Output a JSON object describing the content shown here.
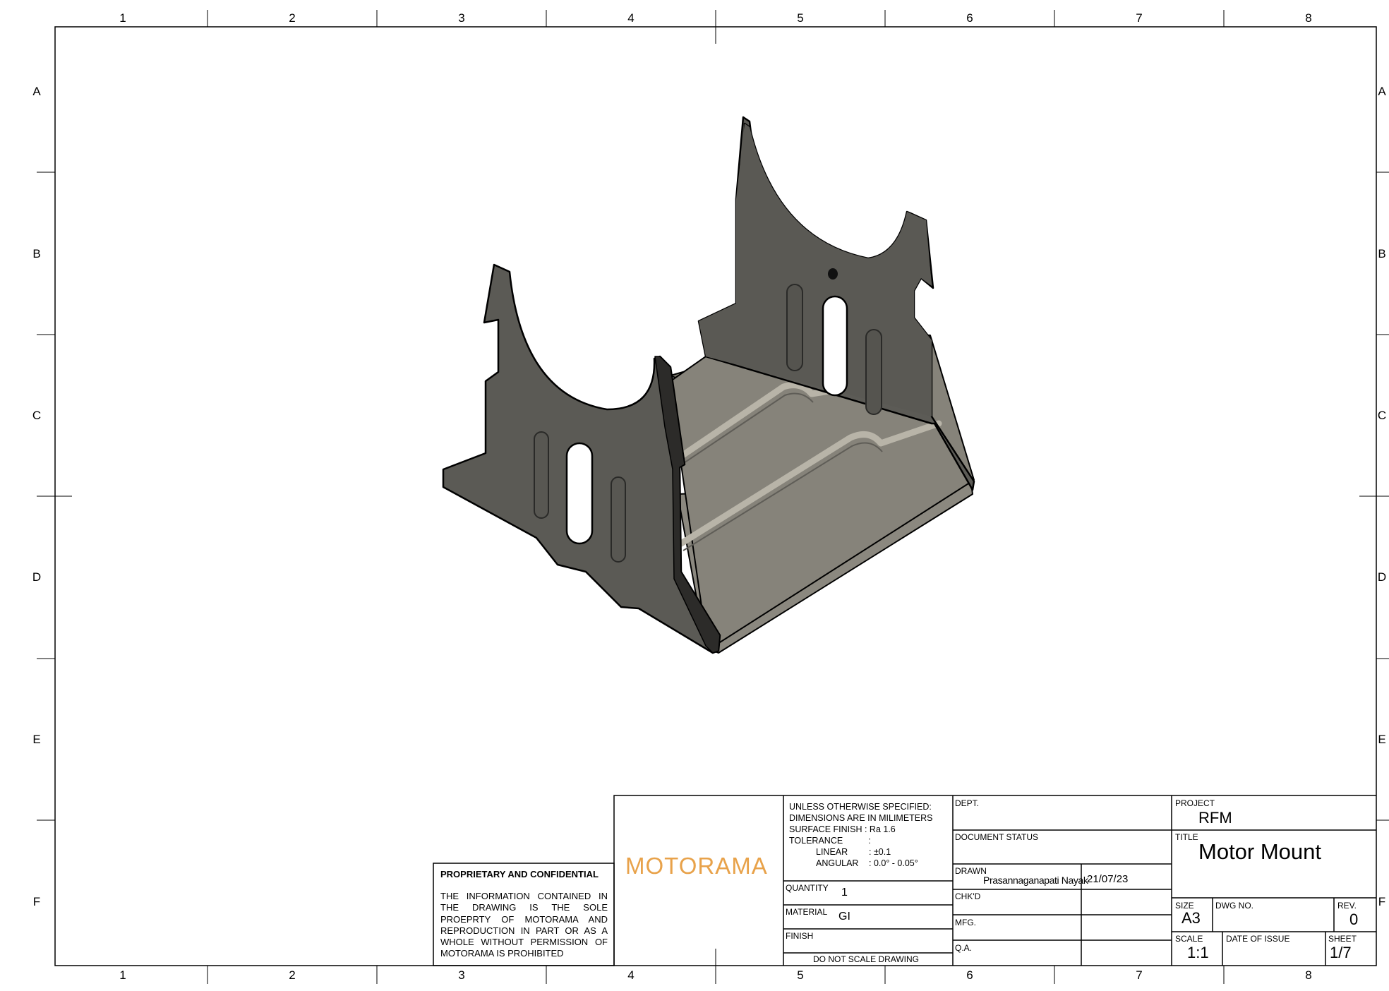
{
  "border": {
    "columns": [
      "1",
      "2",
      "3",
      "4",
      "5",
      "6",
      "7",
      "8"
    ],
    "rows": [
      "A",
      "B",
      "C",
      "D",
      "E",
      "F"
    ]
  },
  "colors": {
    "line": "#000000",
    "part_dark": "#555450",
    "part_mid": "#6a6964",
    "part_light": "#8a877e",
    "logo": "#e8a24a"
  },
  "title_block": {
    "confidential": {
      "heading": "PROPRIETARY AND CONFIDENTIAL",
      "lines": [
        "THE INFORMATION CONTAINED IN",
        "THE DRAWING IS THE SOLE",
        "PROEPRTY OF MOTORAMA AND",
        "REPRODUCTION IN PART OR AS A",
        "WHOLE WITHOUT PERMISSION OF",
        "MOTORAMA IS PROHIBITED"
      ]
    },
    "logo": "MOTORAMA",
    "notes": {
      "line1": "UNLESS OTHERWISE SPECIFIED:",
      "line2": "DIMENSIONS ARE IN MILIMETERS",
      "surface_label": "SURFACE FINISH :",
      "surface_value": "Ra 1.6",
      "tolerance_label": "TOLERANCE",
      "tolerance_colon": ":",
      "linear_label": "LINEAR",
      "linear_value": ":  ±0.1",
      "angular_label": "ANGULAR",
      "angular_value": ":  0.0° - 0.05°"
    },
    "quantity_label": "QUANTITY",
    "quantity": "1",
    "material_label": "MATERIAL",
    "material": "GI",
    "finish_label": "FINISH",
    "do_not_scale": "DO NOT SCALE DRAWING",
    "dept_label": "DEPT.",
    "doc_status_label": "DOCUMENT STATUS",
    "drawn_label": "DRAWN",
    "drawn_by": "Prasannaganapati Nayak",
    "drawn_date": "21/07/23",
    "chkd_label": "CHK'D",
    "mfg_label": "MFG.",
    "qa_label": "Q.A.",
    "project_label": "PROJECT",
    "project": "RFM",
    "title_label": "TITLE",
    "title": "Motor Mount",
    "size_label": "SIZE",
    "size": "A3",
    "dwg_label": "DWG NO.",
    "rev_label": "REV.",
    "rev": "0",
    "scale_label": "SCALE",
    "scale": "1:1",
    "date_issue_label": "DATE OF ISSUE",
    "sheet_label": "SHEET",
    "sheet": "1/7"
  }
}
